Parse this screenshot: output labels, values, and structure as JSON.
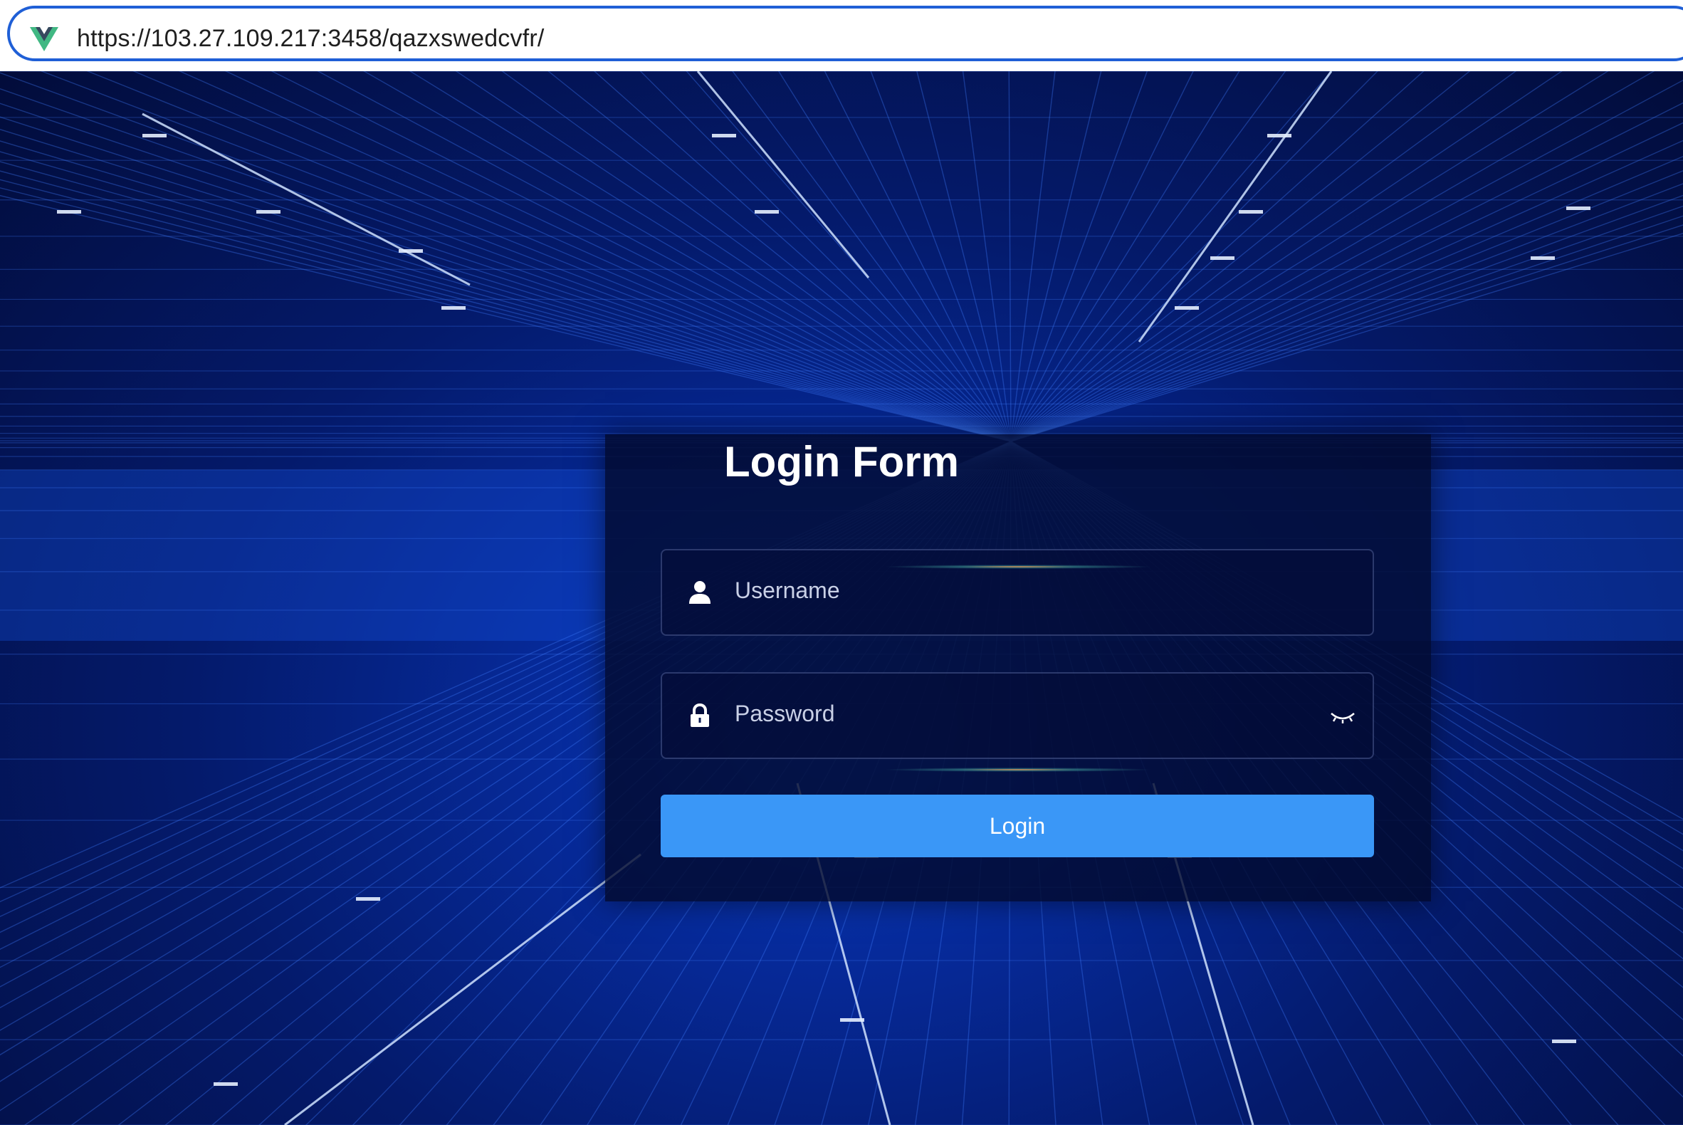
{
  "browser": {
    "url": "https://103.27.109.217:3458/qazxswedcvfr/",
    "site_icon": "vue-logo-icon",
    "accent_color": "#1f5fd6"
  },
  "login_form": {
    "title": "Login Form",
    "username": {
      "placeholder": "Username",
      "value": "",
      "icon": "user-icon"
    },
    "password": {
      "placeholder": "Password",
      "value": "",
      "icon": "lock-icon",
      "toggle_icon": "eye-closed-icon"
    },
    "submit_label": "Login",
    "button_color": "#3a97f7"
  },
  "background": {
    "theme": "blue digital grid",
    "primary_color": "#0a3fc4"
  }
}
